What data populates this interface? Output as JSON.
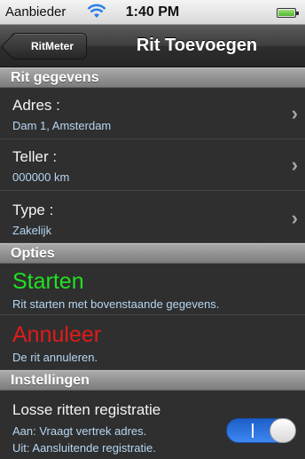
{
  "status_bar": {
    "carrier": "Aanbieder",
    "time": "1:40 PM"
  },
  "nav": {
    "back_label": "RitMeter",
    "title": "Rit Toevoegen"
  },
  "sections": {
    "rit_gegevens": "Rit gegevens",
    "opties": "Opties",
    "instellingen": "Instellingen"
  },
  "rows": {
    "adres": {
      "label": "Adres :",
      "value": "Dam 1, Amsterdam"
    },
    "teller": {
      "label": "Teller :",
      "value": "000000 km"
    },
    "type": {
      "label": "Type :",
      "value": "Zakelijk"
    }
  },
  "actions": {
    "starten": {
      "title": "Starten",
      "description": "Rit starten met bovenstaande gegevens.",
      "color": "#22e022"
    },
    "annuleer": {
      "title": "Annuleer",
      "description": "De rit annuleren.",
      "color": "#e01b1b"
    }
  },
  "settings": {
    "losse_ritten": {
      "label": "Losse ritten registratie",
      "desc_on": "Aan: Vraagt vertrek adres.",
      "desc_off": "Uit: Aansluitende registratie.",
      "toggle_on": true
    }
  }
}
